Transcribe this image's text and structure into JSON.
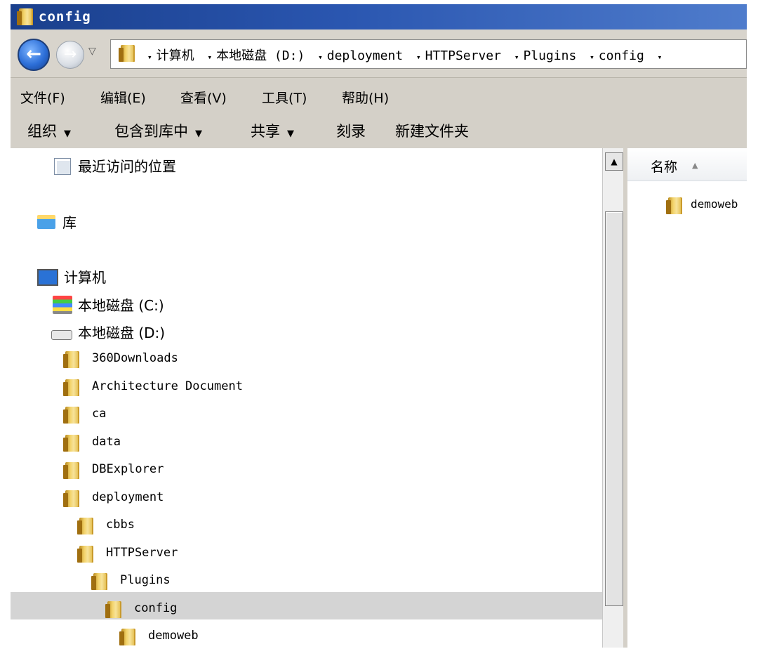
{
  "window": {
    "title": "config"
  },
  "nav": {
    "back_glyph": "←",
    "forward_glyph": "→",
    "history_glyph": "▽",
    "crumb_separator": "▾",
    "breadcrumbs": [
      "计算机",
      "本地磁盘 (D:)",
      "deployment",
      "HTTPServer",
      "Plugins",
      "config"
    ]
  },
  "menu": [
    "文件(F)",
    "编辑(E)",
    "查看(V)",
    "工具(T)",
    "帮助(H)"
  ],
  "commands": [
    {
      "label": "组织",
      "dropdown": true
    },
    {
      "label": "包含到库中",
      "dropdown": true
    },
    {
      "label": "共享",
      "dropdown": true
    },
    {
      "label": "刻录",
      "dropdown": false
    },
    {
      "label": "新建文件夹",
      "dropdown": false
    }
  ],
  "tree": {
    "recent": "最近访问的位置",
    "library": "库",
    "computer": "计算机",
    "drive_c": "本地磁盘 (C:)",
    "drive_d": "本地磁盘 (D:)",
    "folders": [
      {
        "label": "360Downloads",
        "depth": 0
      },
      {
        "label": "Architecture Document",
        "depth": 0
      },
      {
        "label": "ca",
        "depth": 0
      },
      {
        "label": "data",
        "depth": 0
      },
      {
        "label": "DBExplorer",
        "depth": 0
      },
      {
        "label": "deployment",
        "depth": 0
      },
      {
        "label": "cbbs",
        "depth": 1
      },
      {
        "label": "HTTPServer",
        "depth": 1
      },
      {
        "label": "Plugins",
        "depth": 2
      },
      {
        "label": "config",
        "depth": 3,
        "selected": true
      },
      {
        "label": "demoweb",
        "depth": 4
      }
    ]
  },
  "content": {
    "column_header": "名称",
    "sort_glyph": "▲",
    "items": [
      "demoweb"
    ]
  },
  "scrollbar": {
    "up_glyph": "▲"
  },
  "colors": {
    "title_bar": "#1a3f8c",
    "folder": "#f3d36a",
    "selection": "#d4d4d4"
  }
}
